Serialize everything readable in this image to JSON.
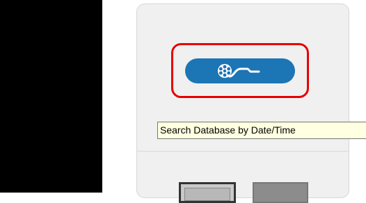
{
  "left_panel": {
    "color": "#000000"
  },
  "side_panel": {
    "background": "#f0f0f0"
  },
  "search_button": {
    "color": "#1c75b4",
    "icon": "film-reel-icon",
    "highlighted": true,
    "highlight_color": "#e60000"
  },
  "tooltip": {
    "text": "Search Database by Date/Time",
    "background": "#ffffe1"
  },
  "bottom_buttons": [
    {
      "name": "bottom-button-1"
    },
    {
      "name": "bottom-button-2"
    }
  ]
}
